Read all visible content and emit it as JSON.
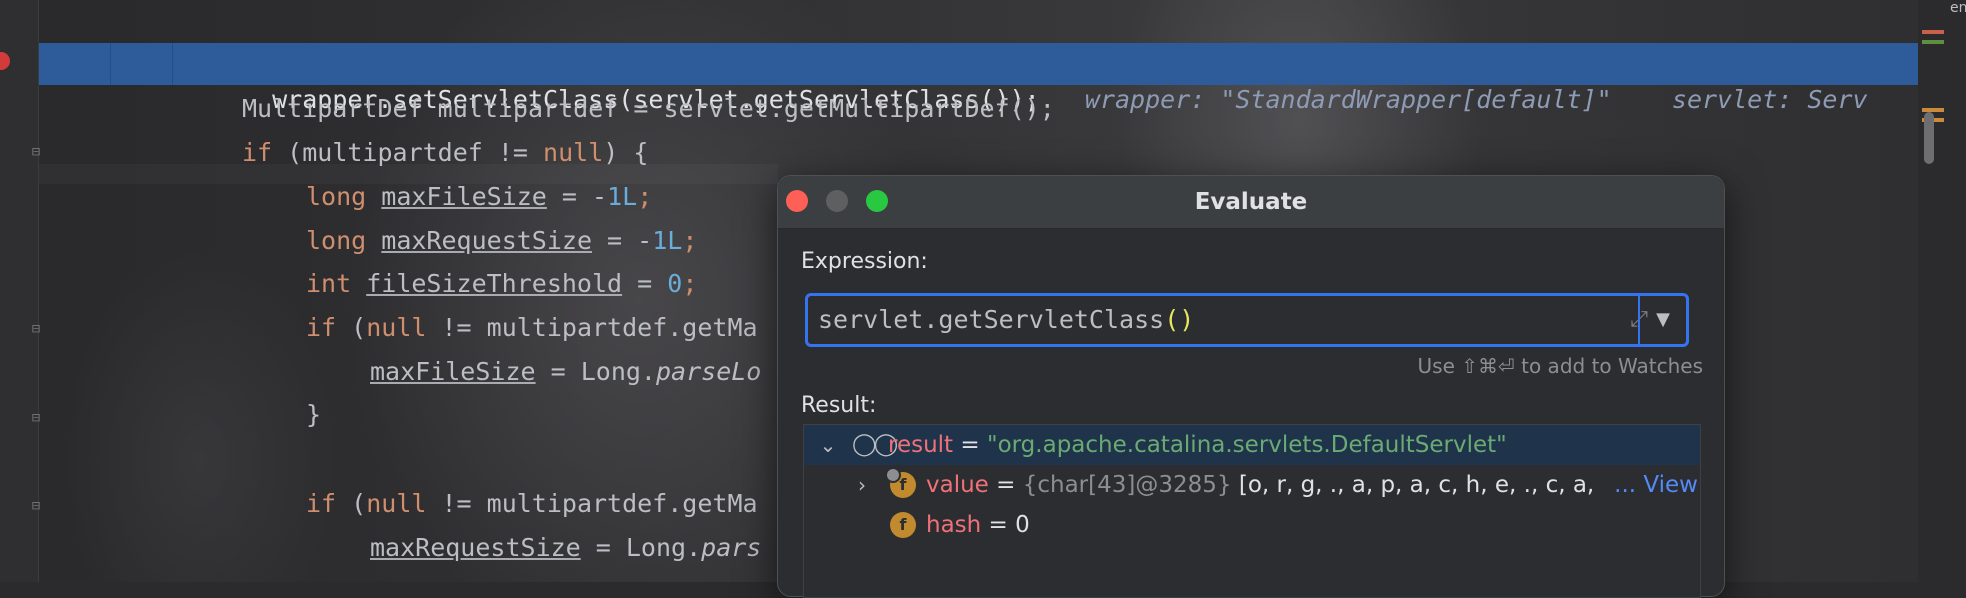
{
  "editor": {
    "line1": {
      "code": "wrapper.setServletClass(servlet.getServletClass());",
      "hint1": "wrapper: \"StandardWrapper[default]\"",
      "hint2": "servlet: Serv"
    },
    "line2": {
      "type": "MultipartDef",
      "rest": " multipartdef = servlet.getMultipartDef();"
    },
    "line3": {
      "kw": "if",
      "mid": " (multipartdef != ",
      "kw2": "null",
      "end": ") {"
    },
    "line4": {
      "kw": "long",
      "var": "maxFileSize",
      "mid": " = -",
      "num": "1L",
      "end": ";"
    },
    "line5": {
      "kw": "long",
      "var": "maxRequestSize",
      "mid": " = -",
      "num": "1L",
      "end": ";"
    },
    "line6": {
      "kw": "int",
      "var": "fileSizeThreshold",
      "mid": " = ",
      "num": "0",
      "end": ";"
    },
    "line7": {
      "kw": "if",
      "mid": " (",
      "kw2": "null",
      "end": " != multipartdef.getMa"
    },
    "line8": {
      "var": "maxFileSize",
      "mid": " = Long.",
      "call": "parseLo"
    },
    "line9": {
      "text": "}"
    },
    "line11": {
      "kw": "if",
      "mid": " (",
      "kw2": "null",
      "end": " != multipartdef.getMa"
    },
    "line12": {
      "var": "maxRequestSize",
      "mid": " = Long.",
      "call": "pars"
    },
    "side_letter": "en"
  },
  "dialog": {
    "title": "Evaluate",
    "expression_label": "Expression:",
    "expression": {
      "prefix": "servlet.getServletClass",
      "parens": "()"
    },
    "watch_hint": "Use ⇧⌘⏎ to add to Watches",
    "result_label": "Result:",
    "result": {
      "name": "result",
      "eq": " = ",
      "value": "\"org.apache.catalina.servlets.DefaultServlet\"",
      "children": [
        {
          "badge": "f",
          "name": "value",
          "eq": " = ",
          "type": "{char[43]@3285}",
          "chars": " [o, r, g, ., a, p, a, c, h, e, ., c, a, ",
          "more": "... View"
        },
        {
          "badge": "f",
          "name": "hash",
          "eq": " = ",
          "value": "0"
        }
      ]
    }
  },
  "colors": {
    "accent": "#3574f0",
    "selection": "#2e5b9a",
    "keyword": "#cf8e6d",
    "number": "#6aaddb",
    "string": "#6aab73",
    "field_name": "#f07178"
  }
}
